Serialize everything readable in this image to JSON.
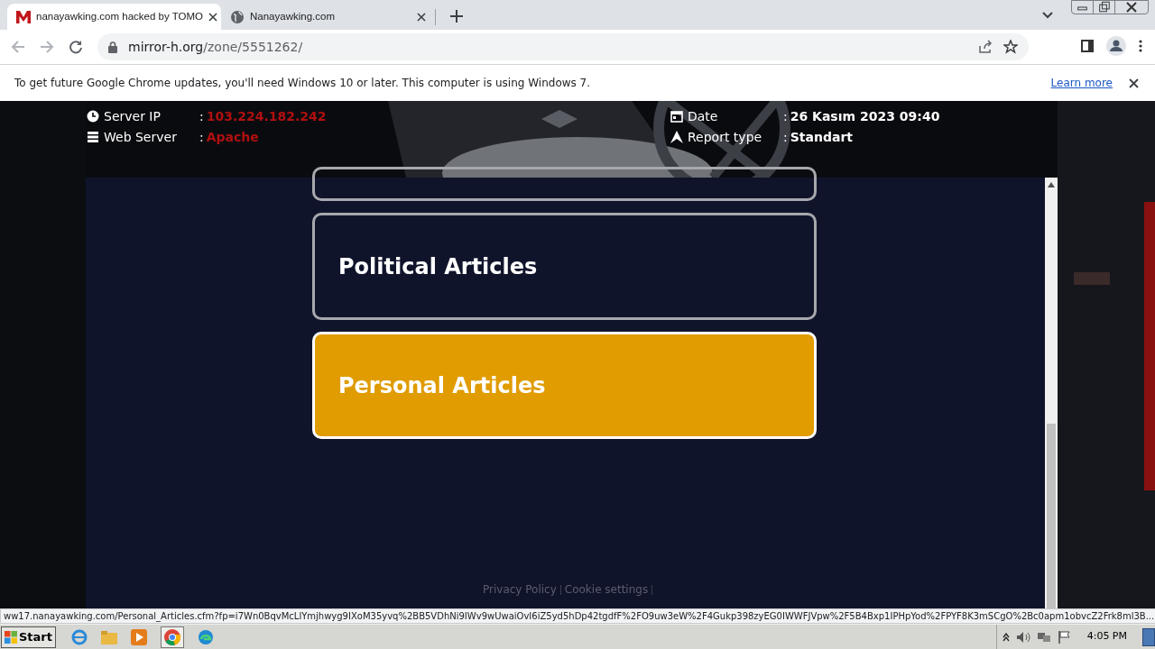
{
  "browser": {
    "tabs": [
      {
        "title": "nanayawking.com hacked by TOMO",
        "selected": true
      },
      {
        "title": "Nanayawking.com",
        "selected": false
      }
    ],
    "address": {
      "host": "mirror-h.org",
      "path": "/zone/5551262/"
    },
    "infobar": {
      "message": "To get future Google Chrome updates, you'll need Windows 10 or later. This computer is using Windows 7.",
      "link": "Learn more"
    }
  },
  "report": {
    "left": [
      {
        "kind": "server",
        "label": "Server IP",
        "separator": ":",
        "value": "103.224.182.242",
        "color": "#b01010"
      },
      {
        "kind": "webserver",
        "label": "Web Server",
        "separator": ":",
        "value": "Apache",
        "color": "#b01010"
      }
    ],
    "right": [
      {
        "kind": "date",
        "label": "Date",
        "separator": ":",
        "value": "26 Kasım 2023 09:40",
        "color": "#ffffff"
      },
      {
        "kind": "type",
        "label": "Report type",
        "separator": ":",
        "value": "Standart",
        "color": "#ffffff"
      }
    ]
  },
  "articles": [
    {
      "title": "Political Articles",
      "selected": false
    },
    {
      "title": "Personal Articles",
      "selected": true
    }
  ],
  "footer_links": [
    "Privacy Policy",
    "Cookie settings"
  ],
  "status_url": "ww17.nanayawking.com/Personal_Articles.cfm?fp=i7Wn0BqvMcLlYmjhwyg9IXoM35yvq%2BB5VDhNi9IWv9wUwaiOvI6iZ5yd5hDp42tgdfF%2FO9uw3eW%2F4Gukp398zyEG0IWWFJVpw%2F5B4Bxp1IPHpYod%2FPYF8K3mSCgO%2Bc0apm1obvcZ2Frk8ml3B...",
  "taskbar": {
    "start": "Start",
    "clock": "4:05 PM"
  }
}
